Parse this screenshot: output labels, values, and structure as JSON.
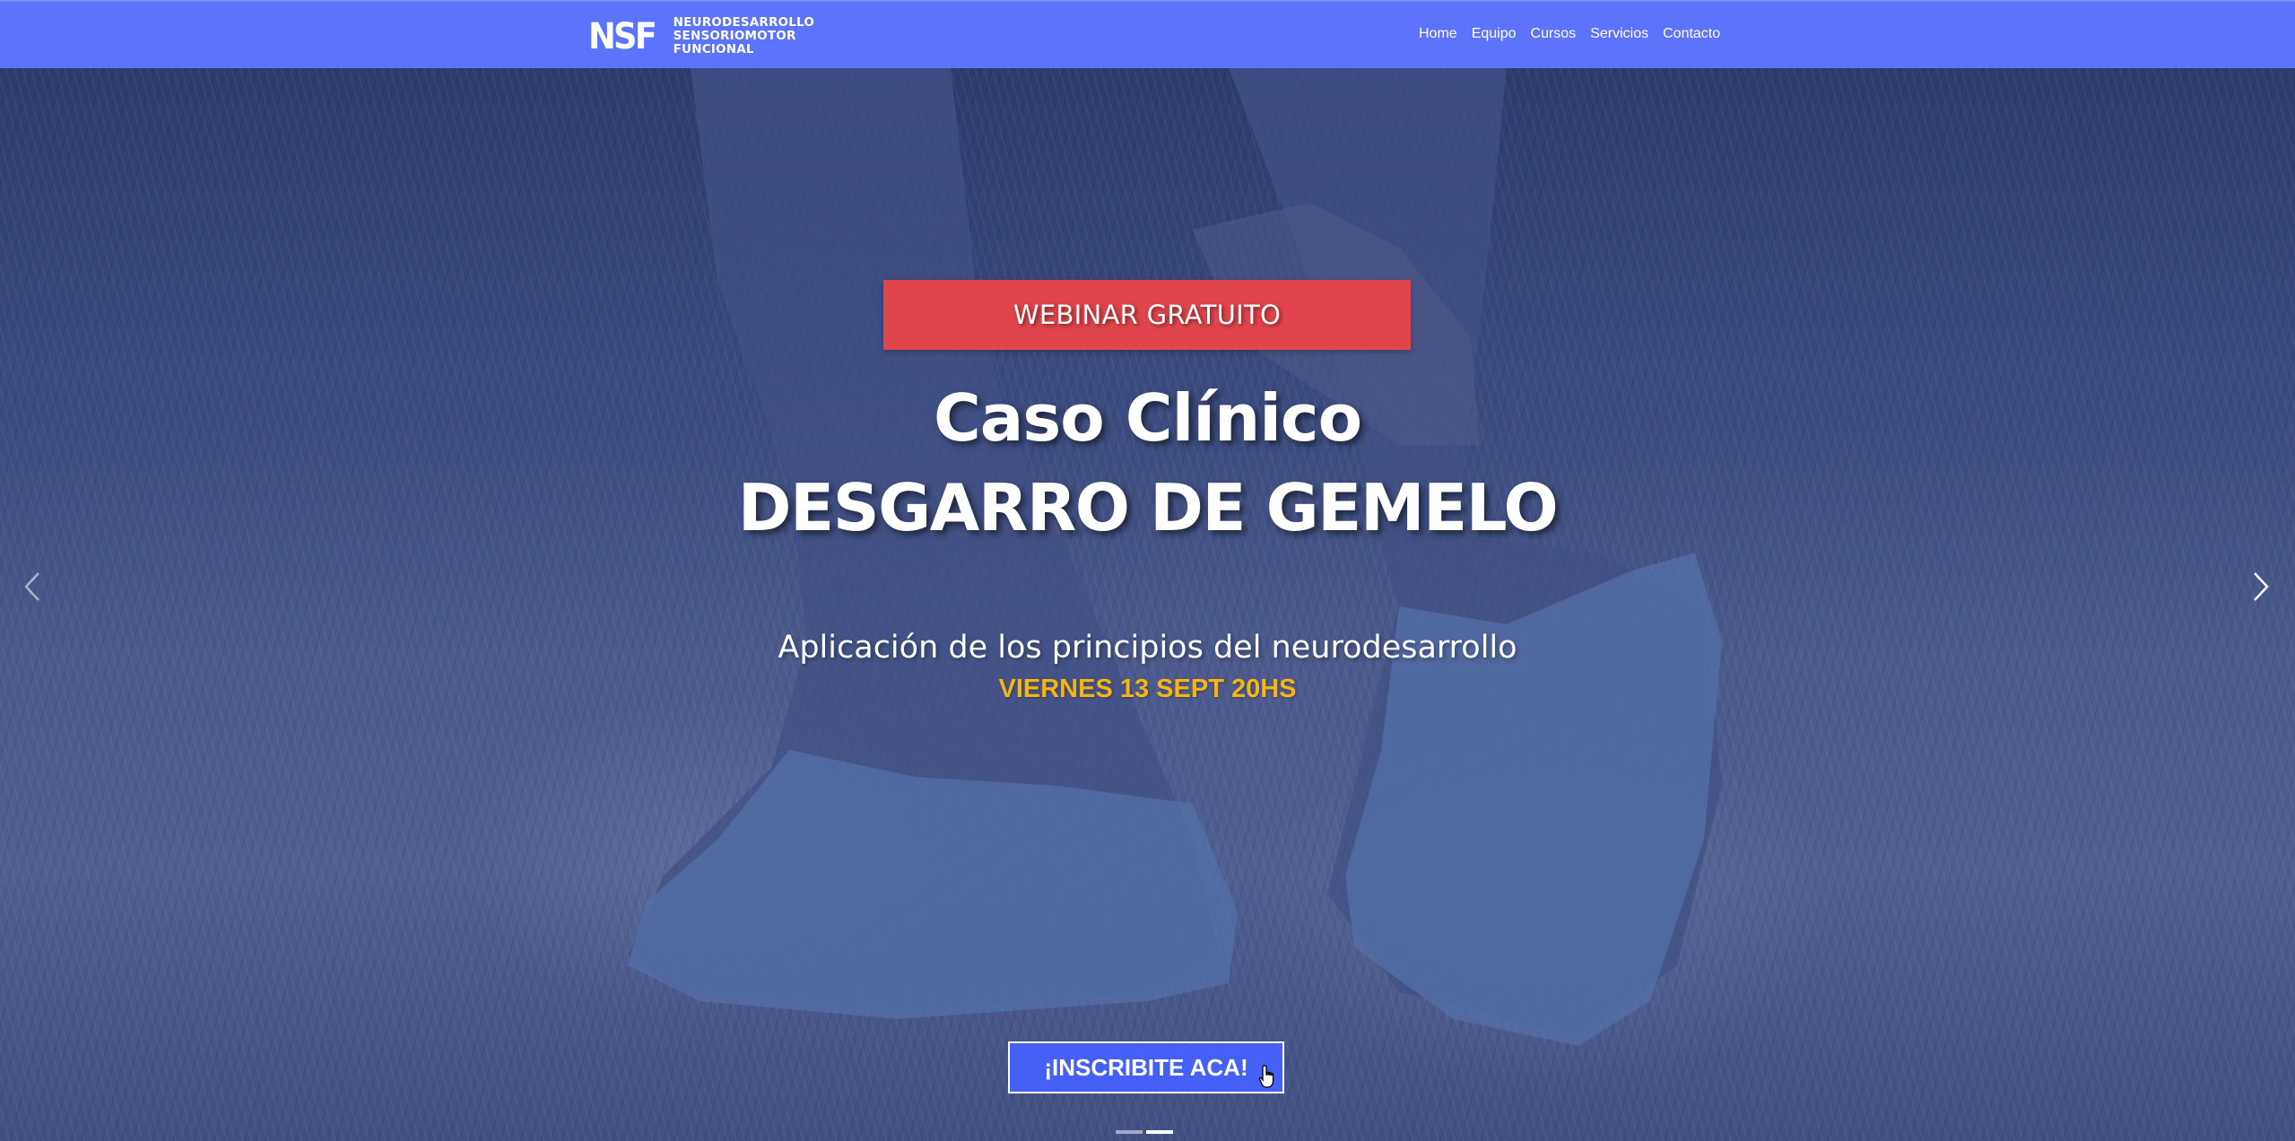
{
  "brand": {
    "mark": "NSF",
    "line1": "NEURODESARROLLO",
    "line2": "SENSORIOMOTOR",
    "line3": "FUNCIONAL"
  },
  "nav": {
    "items": [
      {
        "label": "Home"
      },
      {
        "label": "Equipo"
      },
      {
        "label": "Cursos"
      },
      {
        "label": "Servicios"
      },
      {
        "label": "Contacto"
      }
    ]
  },
  "hero": {
    "badge": "WEBINAR GRATUITO",
    "title_line1": "Caso Clínico",
    "title_line2": "DESGARRO DE GEMELO",
    "subtitle": "Aplicación de los principios del neurodesarrollo",
    "date": "VIERNES 13 SEPT 20HS",
    "cta_label": "¡INSCRIBITE ACA!"
  },
  "carousel": {
    "slides": 2,
    "active": 2
  },
  "colors": {
    "navbar": "#5b74fb",
    "badge": "#e0454b",
    "date": "#f7b512",
    "cta": "#4560f4"
  }
}
